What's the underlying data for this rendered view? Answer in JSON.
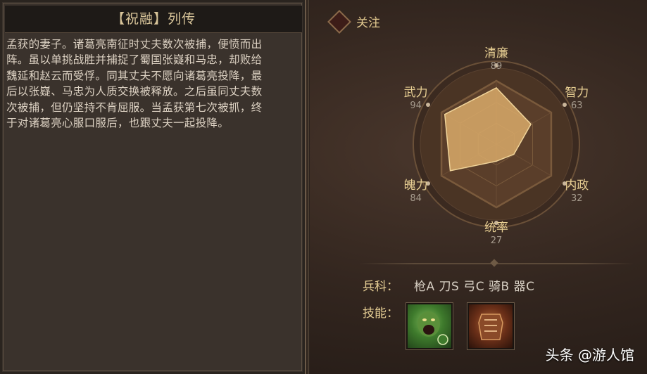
{
  "header": {
    "title": "【祝融】列传"
  },
  "biography": "孟获的妻子。诸葛亮南征时丈夫数次被捕，便愤而出\n阵。虽以单挑战胜并捕捉了蜀国张嶷和马忠，却败给\n魏延和赵云而受俘。同其丈夫不愿向诸葛亮投降，最\n后以张嶷、马忠为人质交换被释放。之后虽同丈夫数\n次被捕，但仍坚持不肯屈服。当孟获第七次被抓，终\n于对诸葛亮心服口服后，也跟丈夫一起投降。",
  "follow": {
    "label": "关注",
    "icon": "diamond-icon"
  },
  "stats": [
    {
      "name": "清廉",
      "value": 89
    },
    {
      "name": "智力",
      "value": 63
    },
    {
      "name": "内政",
      "value": 32
    },
    {
      "name": "统率",
      "value": 27
    },
    {
      "name": "魄力",
      "value": 84
    },
    {
      "name": "武力",
      "value": 94
    }
  ],
  "troops": {
    "label": "兵科：",
    "values": "枪A 刀S 弓C 骑B 器C"
  },
  "skills": {
    "label": "技能：",
    "items": [
      {
        "icon": "roaring-warrior-icon"
      },
      {
        "icon": "armor-icon"
      }
    ]
  },
  "watermark": "头条 @游人馆",
  "colors": {
    "accent": "#e8cf93",
    "fill": "#d9aa6a",
    "panel": "#3a322c"
  }
}
